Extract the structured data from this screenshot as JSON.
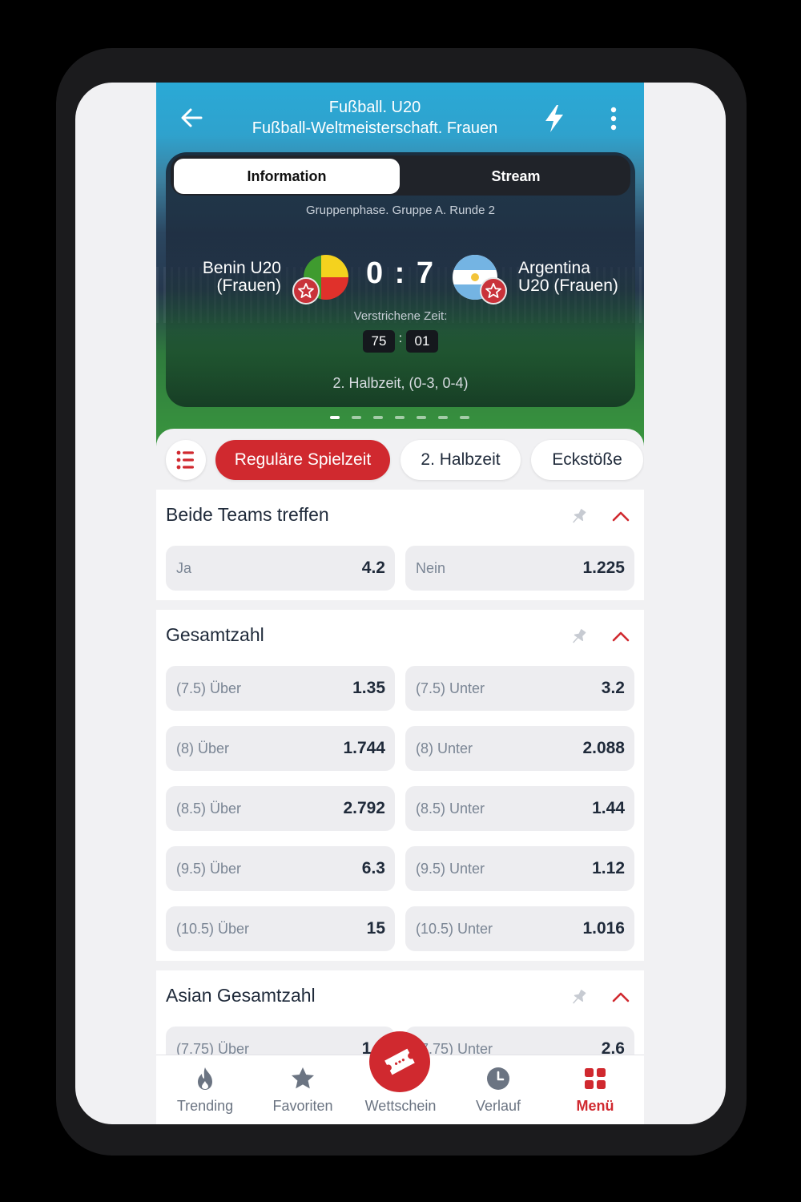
{
  "header": {
    "title_line1": "Fußball. U20",
    "title_line2": "Fußball-Weltmeisterschaft. Frauen"
  },
  "tabs": {
    "information": "Information",
    "stream": "Stream"
  },
  "match": {
    "phase": "Gruppenphase. Gruppe A. Runde 2",
    "team1_line1": "Benin U20",
    "team1_line2": "(Frauen)",
    "team2_line1": "Argentina",
    "team2_line2": "U20 (Frauen)",
    "score": "0 : 7",
    "elapsed_label": "Verstrichene Zeit:",
    "timer_min": "75",
    "timer_sep": ":",
    "timer_sec": "01",
    "half_info": "2. Halbzeit, (0-3, 0-4)",
    "carousel_pages": 7,
    "carousel_active": 1
  },
  "filters": [
    {
      "label": "Reguläre Spielzeit",
      "active": true
    },
    {
      "label": "2. Halbzeit",
      "active": false
    },
    {
      "label": "Eckstöße",
      "active": false
    }
  ],
  "markets": {
    "btts": {
      "title": "Beide Teams treffen",
      "odds": [
        {
          "label": "Ja",
          "value": "4.2"
        },
        {
          "label": "Nein",
          "value": "1.225"
        }
      ]
    },
    "total": {
      "title": "Gesamtzahl",
      "rows": [
        {
          "over_label": "(7.5) Über",
          "over_value": "1.35",
          "under_label": "(7.5) Unter",
          "under_value": "3.2"
        },
        {
          "over_label": "(8) Über",
          "over_value": "1.744",
          "under_label": "(8) Unter",
          "under_value": "2.088"
        },
        {
          "over_label": "(8.5) Über",
          "over_value": "2.792",
          "under_label": "(8.5) Unter",
          "under_value": "1.44"
        },
        {
          "over_label": "(9.5) Über",
          "over_value": "6.3",
          "under_label": "(9.5) Unter",
          "under_value": "1.12"
        },
        {
          "over_label": "(10.5) Über",
          "over_value": "15",
          "under_label": "(10.5) Unter",
          "under_value": "1.016"
        }
      ]
    },
    "asian": {
      "title": "Asian Gesamtzahl",
      "rows": [
        {
          "over_label": "(7.75) Über",
          "over_value": "1.5",
          "under_label": "(7.75) Unter",
          "under_value": "2.6"
        }
      ]
    }
  },
  "nav": {
    "trending": "Trending",
    "favoriten": "Favoriten",
    "wettschein": "Wettschein",
    "verlauf": "Verlauf",
    "menu": "Menü"
  },
  "colors": {
    "accent": "#d0292f",
    "text": "#1f2a3a",
    "muted": "#7a8594",
    "odd_bg": "#ededf0"
  }
}
